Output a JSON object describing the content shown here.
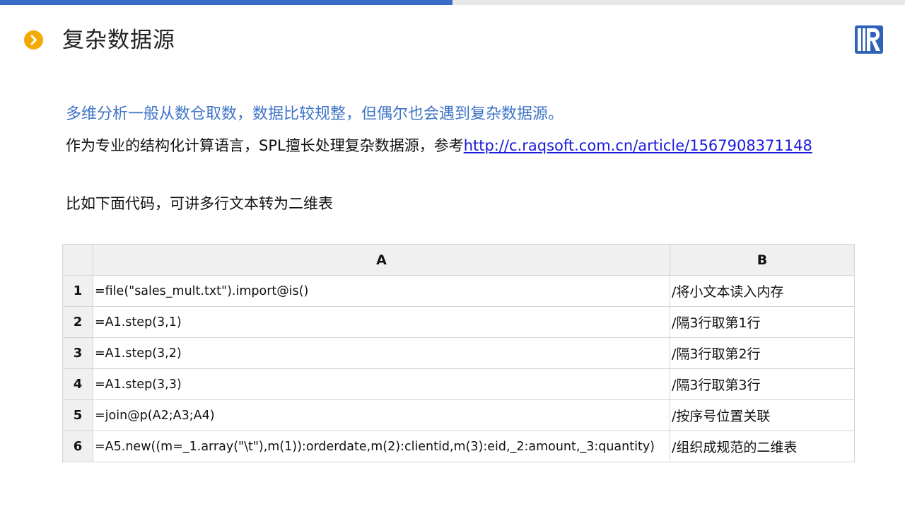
{
  "header": {
    "title": "复杂数据源",
    "accent_color": "#3a6cc6",
    "bullet_color": "#f2a900",
    "bullet_icon": "chevron-right-icon",
    "logo_icon": "raqsoft-logo"
  },
  "content": {
    "highlight": "多维分析一般从数仓取数，数据比较规整，但偶尔也会遇到复杂数据源。",
    "intro_text": "作为专业的结构化计算语言，SPL擅长处理复杂数据源，参考",
    "intro_link": "http://c.raqsoft.com.cn/article/1567908371148",
    "example_text": "比如下面代码，可讲多行文本转为二维表"
  },
  "grid": {
    "columns": [
      "A",
      "B"
    ],
    "rows": [
      {
        "num": "1",
        "a": "=file(\"sales_mult.txt\").import@is()",
        "b": "/将小文本读入内存"
      },
      {
        "num": "2",
        "a": "=A1.step(3,1)",
        "b": "/隔3行取第1行"
      },
      {
        "num": "3",
        "a": "=A1.step(3,2)",
        "b": "/隔3行取第2行"
      },
      {
        "num": "4",
        "a": "=A1.step(3,3)",
        "b": "/隔3行取第3行"
      },
      {
        "num": "5",
        "a": "=join@p(A2;A3;A4)",
        "b": "/按序号位置关联"
      },
      {
        "num": "6",
        "a": "=A5.new((m=_1.array(\"\\t\"),m(1)):orderdate,m(2):clientid,m(3):eid,_2:amount,_3:quantity)",
        "b": "/组织成规范的二维表"
      }
    ]
  }
}
